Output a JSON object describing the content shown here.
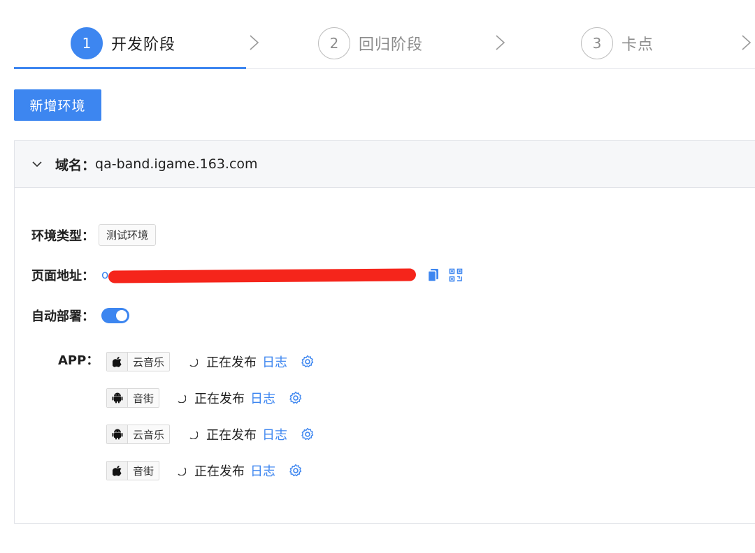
{
  "steps": [
    {
      "number": "1",
      "label": "开发阶段",
      "active": true
    },
    {
      "number": "2",
      "label": "回归阶段",
      "active": false
    },
    {
      "number": "3",
      "label": "卡点",
      "active": false
    }
  ],
  "add_button_label": "新增环境",
  "panel": {
    "domain_label": "域名：",
    "domain_value": "qa-band.igame.163.com",
    "env_type_label": "环境类型：",
    "env_type_value": "测试环境",
    "page_url_label": "页面地址：",
    "page_url_visible": "o",
    "auto_deploy_label": "自动部署：",
    "auto_deploy_on": true,
    "app_label": "APP：",
    "apps": [
      {
        "platform_icon": "apple-icon",
        "name": "云音乐",
        "status": "正在发布",
        "log": "日志"
      },
      {
        "platform_icon": "android-icon",
        "name": "音街",
        "status": "正在发布",
        "log": "日志"
      },
      {
        "platform_icon": "android-icon",
        "name": "云音乐",
        "status": "正在发布",
        "log": "日志"
      },
      {
        "platform_icon": "apple-icon",
        "name": "音街",
        "status": "正在发布",
        "log": "日志"
      }
    ]
  },
  "colors": {
    "primary": "#3d86f0",
    "redaction": "#f5251b"
  }
}
